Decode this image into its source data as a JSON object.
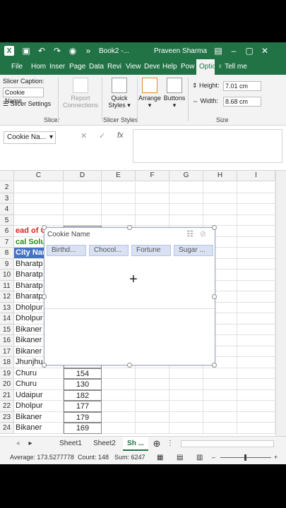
{
  "titlebar": {
    "app_letter": "X",
    "doc": "Book2 -...",
    "user": "Praveen Sharma"
  },
  "tabs": [
    "File",
    "Hom",
    "Inser",
    "Page",
    "Data",
    "Revi",
    "View",
    "Deve",
    "Help",
    "Pow",
    "Optio",
    "Tell me"
  ],
  "ribbon": {
    "slicer_caption_label": "Slicer Caption:",
    "slicer_caption_value": "Cookie Name",
    "slicer_settings": "Slicer Settings",
    "report_connections": [
      "Report",
      "Connections"
    ],
    "quick_styles": [
      "Quick",
      "Styles"
    ],
    "arrange": "Arrange",
    "buttons": "Buttons",
    "height_label": "Height:",
    "height_value": "7.01 cm",
    "width_label": "Width:",
    "width_value": "8.68 cm",
    "group_slicer": "Slicer",
    "group_slicer_styles": "Slicer Styles",
    "group_size": "Size"
  },
  "formula": {
    "namebox": "Cookie Na...",
    "cancel": "✕",
    "enter": "✓",
    "fx": "fx"
  },
  "grid": {
    "columns": [
      "C",
      "D",
      "E",
      "F",
      "G",
      "H",
      "I"
    ],
    "rows": [
      {
        "n": "2",
        "c": "",
        "d": ""
      },
      {
        "n": "3",
        "c": "",
        "d": ""
      },
      {
        "n": "4",
        "c": "",
        "d": ""
      },
      {
        "n": "5",
        "c": "",
        "d": ""
      },
      {
        "n": "6",
        "c": "ead of Cit",
        "d": ""
      },
      {
        "n": "7",
        "c": "cal Solu",
        "d": ""
      },
      {
        "n": "8",
        "c": "City Nam",
        "d": ""
      },
      {
        "n": "9",
        "c": "Bharatp",
        "d": ""
      },
      {
        "n": "10",
        "c": "Bharatp",
        "d": ""
      },
      {
        "n": "11",
        "c": "Bharatp",
        "d": ""
      },
      {
        "n": "12",
        "c": "Bharatp",
        "d": ""
      },
      {
        "n": "13",
        "c": "Dholpur",
        "d": ""
      },
      {
        "n": "14",
        "c": "Dholpur",
        "d": ""
      },
      {
        "n": "15",
        "c": "Bikaner",
        "d": ""
      },
      {
        "n": "16",
        "c": "Bikaner",
        "d": ""
      },
      {
        "n": "17",
        "c": "Bikaner",
        "d": ""
      },
      {
        "n": "18",
        "c": "Jhunjhu",
        "d": ""
      },
      {
        "n": "19",
        "c": "Churu",
        "d": "154"
      },
      {
        "n": "20",
        "c": "Churu",
        "d": "130"
      },
      {
        "n": "21",
        "c": "Udaipur",
        "d": "182"
      },
      {
        "n": "22",
        "c": "Dholpur",
        "d": "177"
      },
      {
        "n": "23",
        "c": "Bikaner",
        "d": "179"
      },
      {
        "n": "24",
        "c": "Bikaner",
        "d": "169"
      }
    ]
  },
  "slicer": {
    "title": "Cookie Name",
    "items": [
      "Birthd...",
      "Chocol...",
      "Fortune",
      "Sugar ..."
    ]
  },
  "sheets": [
    "Sheet1",
    "Sheet2",
    "Sh ..."
  ],
  "status": {
    "average": "Average: 173.5277778",
    "count": "Count: 148",
    "sum": "Sum: 6247"
  },
  "colors": {
    "excel_green": "#217346",
    "red_text": "#d9241c",
    "green_text": "#2c8a1f",
    "header_fill": "#4472c4"
  }
}
